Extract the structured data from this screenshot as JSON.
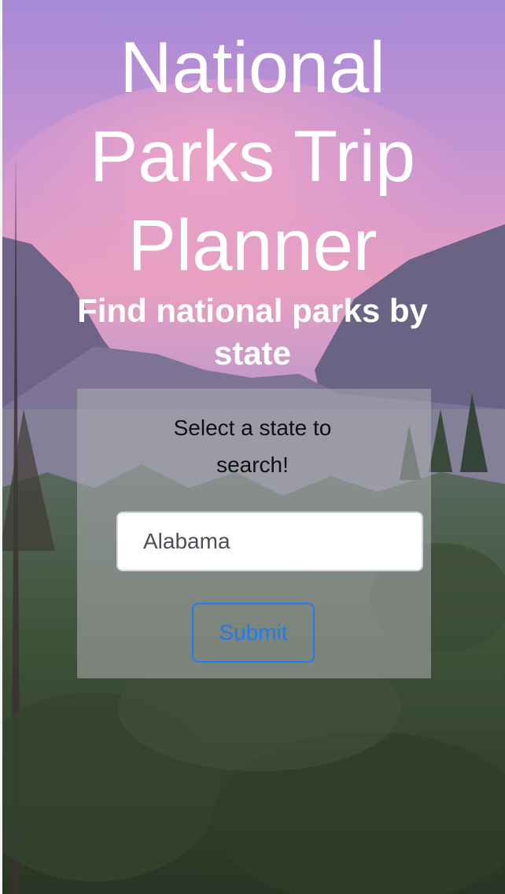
{
  "header": {
    "title_lines": [
      "National",
      "Parks Trip",
      "Planner"
    ],
    "subtitle": "Find national parks by state"
  },
  "search_panel": {
    "prompt": "Select a state to search!",
    "state_select": {
      "selected_value": "Alabama"
    },
    "submit_label": "Submit"
  },
  "colors": {
    "title_text": "#ffffff",
    "panel_background": "rgba(175,175,180,0.55)",
    "button_accent": "#1e7cf2",
    "select_text": "#495057"
  }
}
